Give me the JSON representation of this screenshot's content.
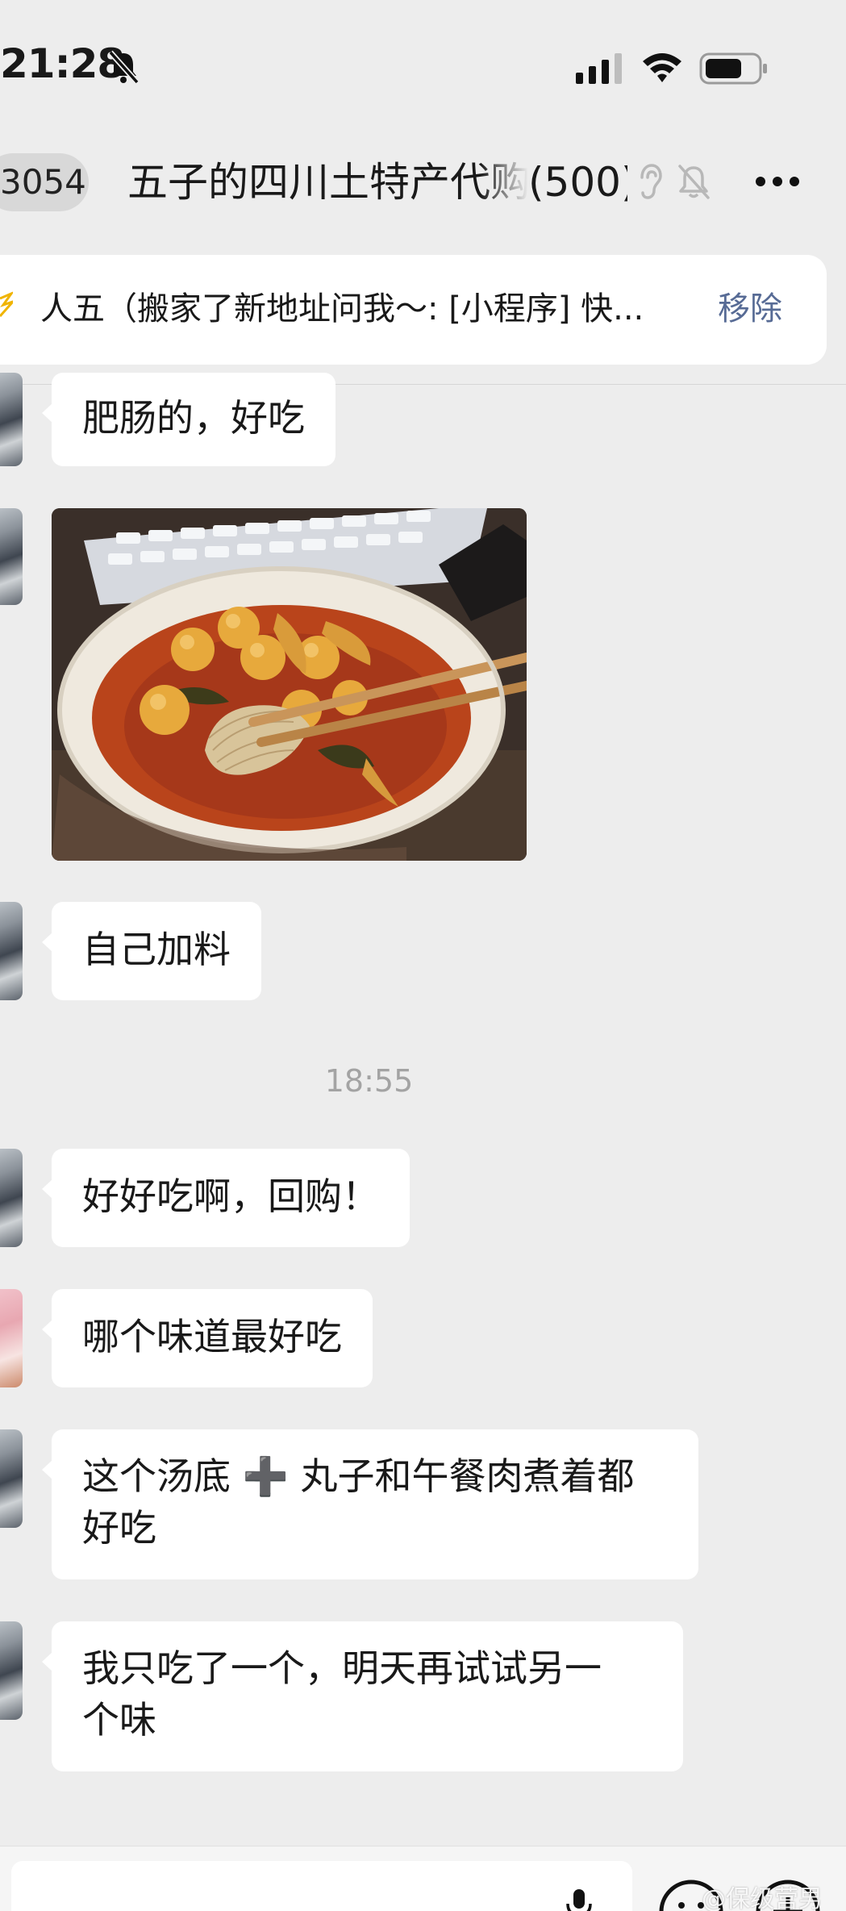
{
  "status_bar": {
    "time": "21:28",
    "icons": [
      "bell-off-icon",
      "signal-icon",
      "wifi-icon",
      "battery-icon"
    ]
  },
  "nav": {
    "back_badge": "3054",
    "title": "五子的四川土特产代购",
    "member_count": "(500)",
    "icons": [
      "ear-icon",
      "bell-off-icon",
      "more-icon"
    ]
  },
  "pinned": {
    "text": "人五（搬家了新地址问我～: [小程序] 快...",
    "remove_label": "移除"
  },
  "messages": [
    {
      "type": "text",
      "text": "肥肠的，好吃"
    },
    {
      "type": "image",
      "description": "photo"
    },
    {
      "type": "text",
      "text": "自己加料"
    },
    {
      "type": "time",
      "text": "18:55"
    },
    {
      "type": "text",
      "text": "好好吃啊，回购！"
    },
    {
      "type": "text",
      "text": "哪个味道最好吃"
    },
    {
      "type": "text",
      "line1": "这个汤底 ➕ 丸子和午餐肉煮着都",
      "line2": "好吃"
    },
    {
      "type": "text",
      "line1": "我只吃了一个，明天再试试另一",
      "line2": "个味"
    }
  ],
  "watermark": "@保级营男",
  "colors": {
    "background": "#ededed",
    "bubble": "#ffffff",
    "link_blue": "#576b95",
    "timestamp_gray": "#a3a3a3"
  }
}
